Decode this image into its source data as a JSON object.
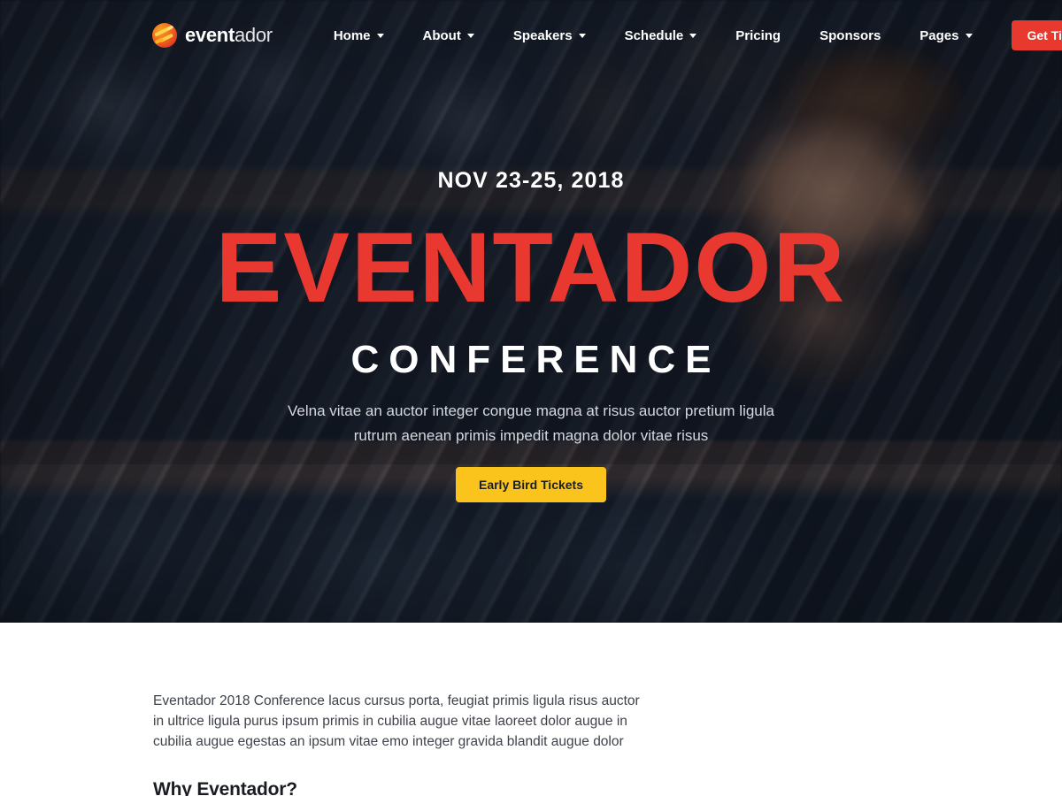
{
  "brand": {
    "name_bold": "event",
    "name_light": "ador",
    "logo_icon": "eventador-flame-circle-logo"
  },
  "nav": {
    "items": [
      {
        "label": "Home",
        "has_dropdown": true
      },
      {
        "label": "About",
        "has_dropdown": true
      },
      {
        "label": "Speakers",
        "has_dropdown": true
      },
      {
        "label": "Schedule",
        "has_dropdown": true
      },
      {
        "label": "Pricing",
        "has_dropdown": false
      },
      {
        "label": "Sponsors",
        "has_dropdown": false
      },
      {
        "label": "Pages",
        "has_dropdown": true
      }
    ],
    "cta_label": "Get Ticket"
  },
  "hero": {
    "date": "NOV 23-25, 2018",
    "title": "EVENTADOR",
    "subtitle": "CONFERENCE",
    "description": "Velna vitae an auctor integer congue magna at risus auctor pretium ligula rutrum aenean primis impedit magna dolor vitae risus",
    "cta_label": "Early Bird Tickets"
  },
  "about": {
    "paragraph": "Eventador 2018 Conference lacus cursus porta, feugiat primis ligula risus auctor in ultrice ligula purus ipsum primis in cubilia augue vitae laoreet dolor augue in cubilia augue egestas an ipsum vitae emo integer gravida blandit augue dolor",
    "heading": "Why Eventador?"
  },
  "colors": {
    "brand_red": "#e8392f",
    "title_red": "#e8382f",
    "accent_yellow": "#fbc41d",
    "hero_dark": "#111622",
    "body_text": "#3d424b",
    "heading_text": "#191c22"
  }
}
